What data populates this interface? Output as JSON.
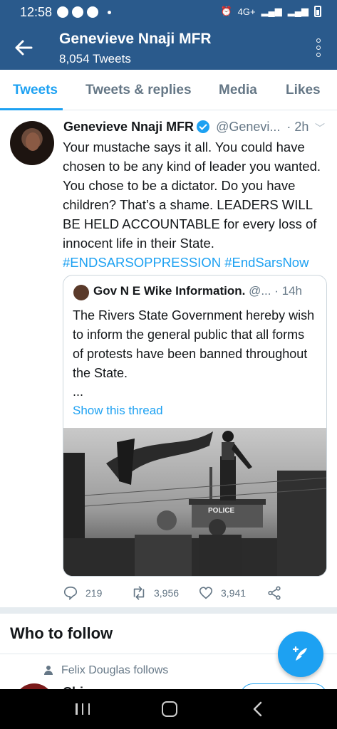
{
  "status_bar": {
    "time": "12:58",
    "network": "4G+"
  },
  "header": {
    "title": "Genevieve Nnaji MFR",
    "subtitle": "8,054 Tweets"
  },
  "tabs": [
    {
      "label": "Tweets",
      "active": true
    },
    {
      "label": "Tweets & replies",
      "active": false
    },
    {
      "label": "Media",
      "active": false
    },
    {
      "label": "Likes",
      "active": false
    }
  ],
  "tweet": {
    "name": "Genevieve Nnaji MFR",
    "handle": "@Genevi...",
    "time": "· 2h",
    "text": "Your mustache says it all. You could have chosen to be any kind of leader you wanted. You chose to be a dictator. Do you have children? That’s a shame. LEADERS WILL BE HELD ACCOUNTABLE for every loss of innocent life in their State.",
    "hashtags": "#ENDSARSOPPRESSION #EndSarsNow",
    "quote": {
      "name": "Gov N E Wike Information.",
      "handle": "@...",
      "time": "· 14h",
      "text": "The Rivers State Government hereby wish to inform the general public that all forms of protests have been banned throughout the State.",
      "ellipsis": "...",
      "show_thread": "Show this thread",
      "photo_sign": "POLICE"
    },
    "actions": {
      "replies": "219",
      "retweets": "3,956",
      "likes": "3,941"
    }
  },
  "who_to_follow": {
    "title": "Who to follow",
    "follows_text": "Felix Douglas follows",
    "partial_name": "Chi"
  },
  "colors": {
    "brand": "#1da1f2",
    "appbar": "#2a5a8c"
  }
}
